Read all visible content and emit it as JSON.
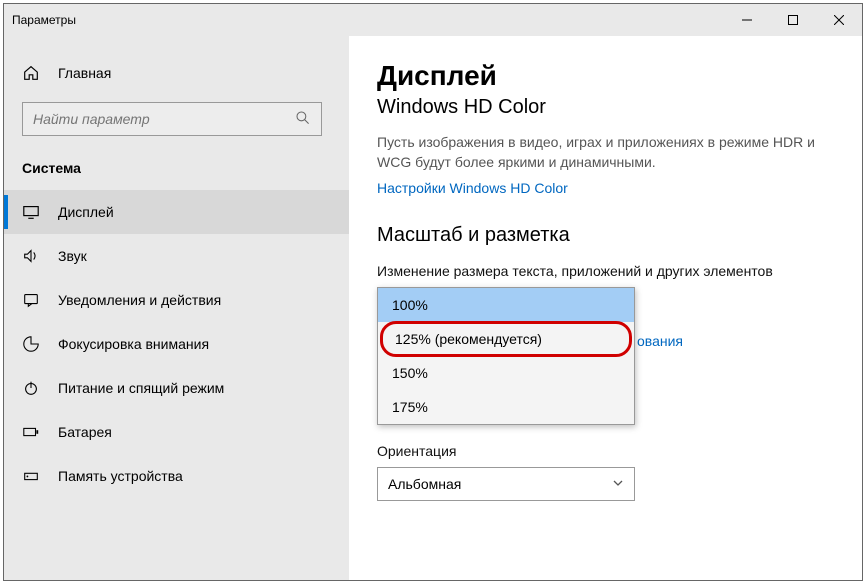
{
  "window": {
    "title": "Параметры"
  },
  "sidebar": {
    "home": "Главная",
    "search_placeholder": "Найти параметр",
    "category": "Система",
    "items": [
      {
        "label": "Дисплей"
      },
      {
        "label": "Звук"
      },
      {
        "label": "Уведомления и действия"
      },
      {
        "label": "Фокусировка внимания"
      },
      {
        "label": "Питание и спящий режим"
      },
      {
        "label": "Батарея"
      },
      {
        "label": "Память устройства"
      }
    ]
  },
  "content": {
    "title": "Дисплей",
    "subtitle": "Windows HD Color",
    "hdr_desc": "Пусть изображения в видео, играх и приложениях в режиме HDR и WCG будут более яркими и динамичными.",
    "hdr_link": "Настройки Windows HD Color",
    "scale_heading": "Масштаб и разметка",
    "scale_label": "Изменение размера текста, приложений и других элементов",
    "scale_options": [
      "100%",
      "125% (рекомендуется)",
      "150%",
      "175%"
    ],
    "behind_link_fragment": "ования",
    "orientation_label": "Ориентация",
    "orientation_value": "Альбомная"
  }
}
